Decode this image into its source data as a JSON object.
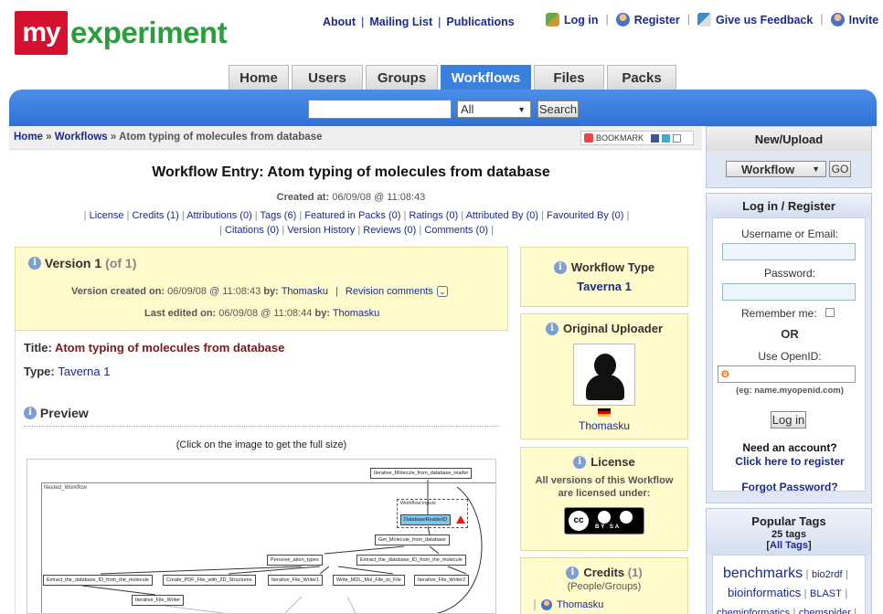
{
  "logo": {
    "my": "my",
    "experiment": "experiment"
  },
  "toplinks": {
    "about": "About",
    "mailing": "Mailing List",
    "publications": "Publications"
  },
  "userlinks": {
    "login": "Log in",
    "register": "Register",
    "feedback": "Give us Feedback",
    "invite": "Invite"
  },
  "tabs": [
    "Home",
    "Users",
    "Groups",
    "Workflows",
    "Files",
    "Packs"
  ],
  "search": {
    "select_value": "All",
    "button": "Search"
  },
  "breadcrumb": {
    "home": "Home",
    "sep": "»",
    "workflows": "Workflows",
    "current": "Atom typing of molecules from database"
  },
  "bookmark": "BOOKMARK",
  "entry": {
    "title": "Workflow Entry: Atom typing of molecules from database",
    "created_label": "Created at:",
    "created_value": "06/09/08 @ 11:08:43",
    "links_row1": [
      "License",
      "Credits (1)",
      "Attributions (0)",
      "Tags (6)",
      "Featured in Packs (0)",
      "Ratings (0)",
      "Attributed By (0)",
      "Favourited By (0)"
    ],
    "links_row2": [
      "Citations (0)",
      "Version History",
      "Reviews (0)",
      "Comments (0)"
    ]
  },
  "version": {
    "heading": "Version 1",
    "of": "(of 1)",
    "created_label": "Version created on:",
    "created_value": "06/09/08 @ 11:08:43",
    "by_label": "by:",
    "created_by": "Thomasku",
    "revision_comments": "Revision comments",
    "edited_label": "Last edited on:",
    "edited_value": "06/09/08 @ 11:08:44",
    "edited_by": "Thomasku",
    "title_label": "Title:",
    "title_value": "Atom typing of molecules from database",
    "type_label": "Type:",
    "type_value": "Taverna 1",
    "preview_heading": "Preview",
    "click_note": "(Click on the image to get the full size)"
  },
  "diagram": {
    "outer_node": "Iterative_Molecule_from_database_reader",
    "nested_label": "Nested_Workflow",
    "inputs_label": "Workflow inputs",
    "input_port": "DatabaseReaderID",
    "nodes": [
      "Get_Molecule_from_database",
      "Perceive_atom_types",
      "Extract_the_database_ID_from_the_molecule",
      "Extract_the_database_ID_from_the_molecule",
      "Create_PDF_File_with_2D_Structures",
      "Iterative_File_Writer1",
      "Write_MDL_Mol_File_to_File",
      "Iterative_File_Writer2",
      "Iterative_File_Writer"
    ]
  },
  "workflow_type": {
    "heading": "Workflow Type",
    "value": "Taverna 1"
  },
  "uploader": {
    "heading": "Original Uploader",
    "name": "Thomasku"
  },
  "license": {
    "heading": "License",
    "text": "All versions of this Workflow are licensed under:",
    "badge": "BY SA",
    "cc": "cc"
  },
  "credits": {
    "heading": "Credits",
    "count": "(1)",
    "sub": "(People/Groups)",
    "person": "Thomasku"
  },
  "newupload": {
    "heading": "New/Upload",
    "select_value": "Workflow",
    "go": "GO"
  },
  "login": {
    "heading": "Log in / Register",
    "username_label": "Username or Email:",
    "password_label": "Password:",
    "remember_label": "Remember me:",
    "or": "OR",
    "openid_label": "Use OpenID:",
    "openid_example": "(eg: name.myopenid.com)",
    "button": "Log in",
    "need_account": "Need an account?",
    "register_link": "Click here to register",
    "forgot": "Forgot Password?"
  },
  "tags": {
    "heading": "Popular Tags",
    "count": "25 tags",
    "all_tags": "All Tags",
    "items": [
      "benchmarks",
      "bio2rdf",
      "bioinformatics",
      "BLAST",
      "cheminformatics",
      "chemspider"
    ]
  }
}
